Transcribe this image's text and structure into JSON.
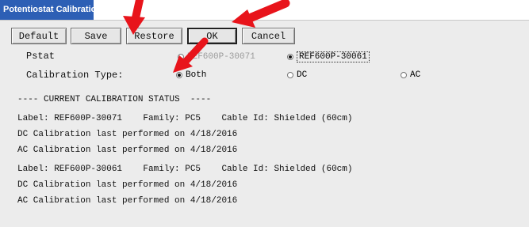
{
  "window": {
    "title": "Potentiostat Calibration"
  },
  "toolbar": {
    "default_label": "Default",
    "save_label": "Save",
    "restore_label": "Restore",
    "ok_label": "OK",
    "cancel_label": "Cancel"
  },
  "pstat": {
    "label": "Pstat",
    "options": [
      "REF600P-30071",
      "REF600P-30061"
    ],
    "selected": "REF600P-30061"
  },
  "calibration_type": {
    "label": "Calibration Type:",
    "options": [
      "Both",
      "DC",
      "AC"
    ],
    "selected": "Both"
  },
  "status": {
    "header": "---- CURRENT CALIBRATION STATUS  ----",
    "lines": [
      "Label: REF600P-30071    Family: PC5    Cable Id: Shielded (60cm)",
      "DC Calibration last performed on 4/18/2016",
      "AC Calibration last performed on 4/18/2016",
      "Label: REF600P-30061    Family: PC5    Cable Id: Shielded (60cm)",
      "DC Calibration last performed on 4/18/2016",
      "AC Calibration last performed on 4/18/2016"
    ]
  },
  "colors": {
    "title_bar": "#2d5fb5",
    "annotation_arrow": "#e8141b"
  }
}
